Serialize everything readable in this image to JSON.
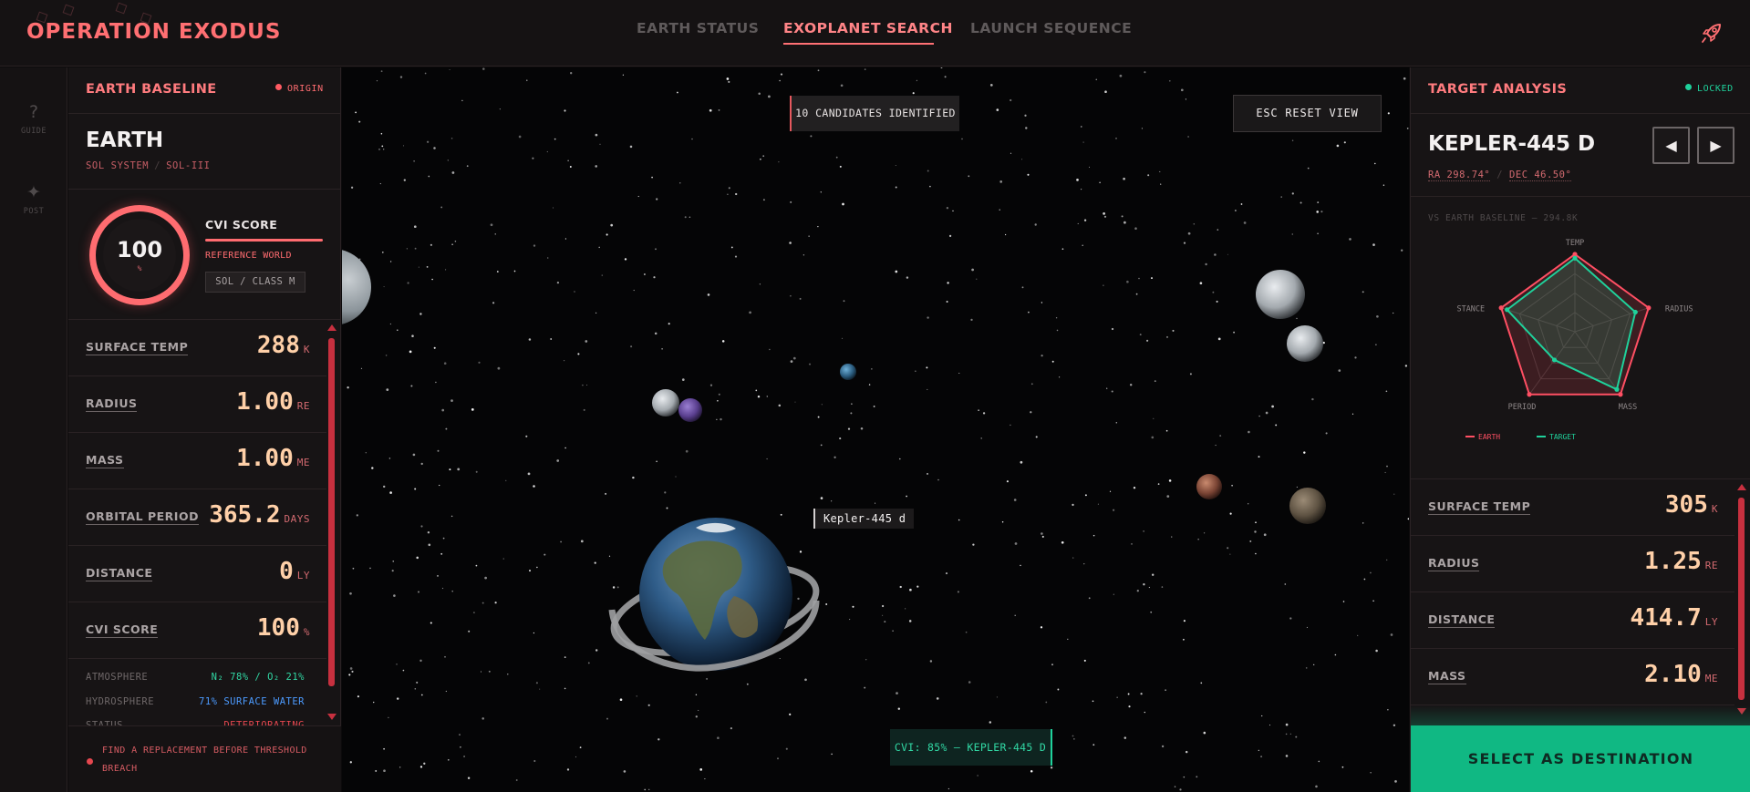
{
  "app": {
    "title": "OPERATION EXODUS"
  },
  "nav": {
    "items": [
      "EARTH STATUS",
      "EXOPLANET SEARCH",
      "LAUNCH SEQUENCE"
    ],
    "active": "EXOPLANET SEARCH"
  },
  "rail": {
    "guide_label": "GUIDE",
    "post_label": "POST"
  },
  "left_panel": {
    "header_title": "EARTH BASELINE",
    "header_badge": "ORIGIN",
    "planet_name": "EARTH",
    "system": "SOL SYSTEM",
    "designation": "SOL-III",
    "cvi_ring_value": "100",
    "cvi_ring_unit": "%",
    "cvi_label": "CVI SCORE",
    "reference_text": "REFERENCE WORLD",
    "class_tag": "SOL / CLASS M",
    "stats": [
      {
        "label": "SURFACE TEMP",
        "value": "288",
        "unit": "K"
      },
      {
        "label": "RADIUS",
        "value": "1.00",
        "unit": "RE"
      },
      {
        "label": "MASS",
        "value": "1.00",
        "unit": "ME"
      },
      {
        "label": "ORBITAL PERIOD",
        "value": "365.2",
        "unit": "DAYS"
      },
      {
        "label": "DISTANCE",
        "value": "0",
        "unit": "LY"
      },
      {
        "label": "CVI SCORE",
        "value": "100",
        "unit": "%"
      }
    ],
    "details": [
      {
        "key": "ATMOSPHERE",
        "value": "N₂ 78% / O₂ 21%"
      },
      {
        "key": "HYDROSPHERE",
        "value": "71% SURFACE WATER"
      },
      {
        "key": "STATUS",
        "value": "DETERIORATING"
      }
    ],
    "footer_message": "FIND A REPLACEMENT BEFORE THRESHOLD BREACH"
  },
  "space_view": {
    "candidates_text": "10 CANDIDATES IDENTIFIED",
    "reset_button": "ESC RESET VIEW",
    "selected_label": "Kepler-445 d",
    "cvi_tag": "CVI: 85% — KEPLER-445 D"
  },
  "right_panel": {
    "header_title": "TARGET ANALYSIS",
    "header_badge": "LOCKED",
    "planet_name": "KEPLER-445 D",
    "ra": "RA 298.74°",
    "dec": "DEC 46.50°",
    "vs_label": "VS EARTH BASELINE — 294.8K",
    "stats": [
      {
        "label": "SURFACE TEMP",
        "value": "305",
        "unit": "K"
      },
      {
        "label": "RADIUS",
        "value": "1.25",
        "unit": "RE"
      },
      {
        "label": "DISTANCE",
        "value": "414.7",
        "unit": "LY"
      },
      {
        "label": "MASS",
        "value": "2.10",
        "unit": "ME"
      }
    ],
    "select_button": "SELECT AS DESTINATION"
  },
  "chart_data": {
    "type": "radar",
    "axes": [
      "TEMP",
      "RADIUS",
      "MASS",
      "PERIOD",
      "DISTANCE"
    ],
    "series": [
      {
        "name": "EARTH",
        "values": [
          1.0,
          1.0,
          1.0,
          1.0,
          1.0
        ],
        "color": "#ff4f63"
      },
      {
        "name": "TARGET",
        "values": [
          0.95,
          0.82,
          0.92,
          0.45,
          0.92
        ],
        "color": "#1fd19b"
      }
    ],
    "range": [
      0,
      1
    ],
    "legend_position": "bottom-left"
  },
  "colors": {
    "accent": "#ff6f72",
    "value": "#ffd0a8",
    "target": "#1fd19b",
    "select": "#10b883"
  }
}
